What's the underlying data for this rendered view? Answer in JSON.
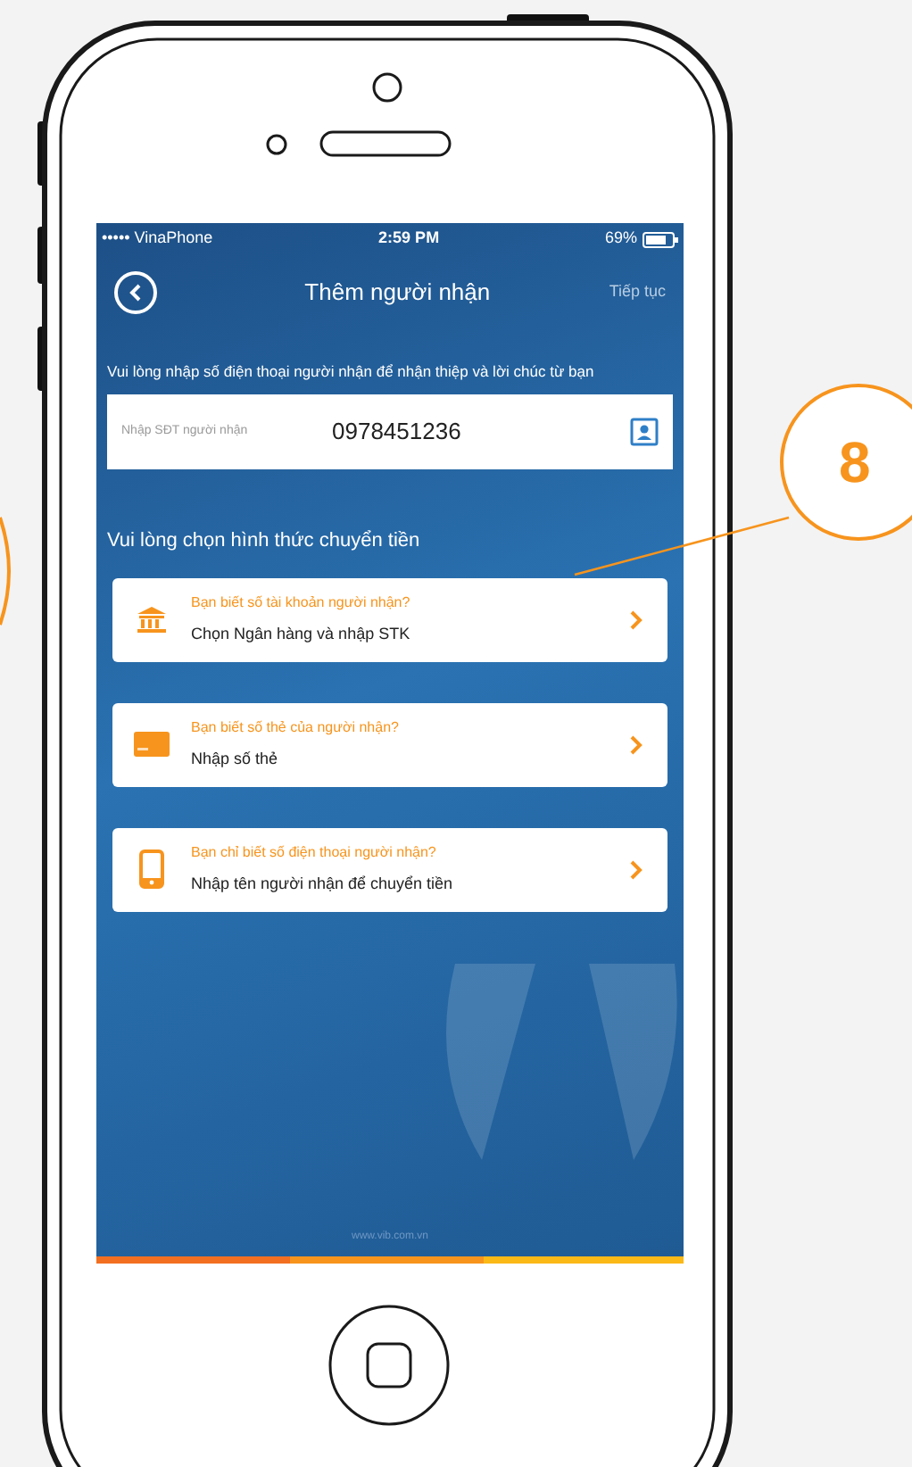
{
  "status_bar": {
    "carrier": "••••• VinaPhone",
    "time": "2:59 PM",
    "battery": "69%"
  },
  "header": {
    "title": "Thêm người nhận",
    "action": "Tiếp tục"
  },
  "instruction": "Vui lòng nhập số điện thoại người nhận để nhận thiệp và lời chúc từ bạn",
  "phone_field": {
    "placeholder": "Nhập SĐT người nhận",
    "value": "0978451236"
  },
  "section_title": "Vui lòng chọn hình thức chuyển tiền",
  "options": [
    {
      "kind": "bank",
      "question": "Bạn biết số tài khoản người nhận?",
      "action": "Chọn Ngân hàng và nhập STK"
    },
    {
      "kind": "card",
      "question": "Bạn biết số thẻ của người nhận?",
      "action": "Nhập số thẻ"
    },
    {
      "kind": "phone",
      "question": "Bạn chỉ biết số điện thoại người nhận?",
      "action": "Nhập tên người nhận để chuyển tiền"
    }
  ],
  "footer": "www.vib.com.vn",
  "callout": {
    "label": "8"
  }
}
